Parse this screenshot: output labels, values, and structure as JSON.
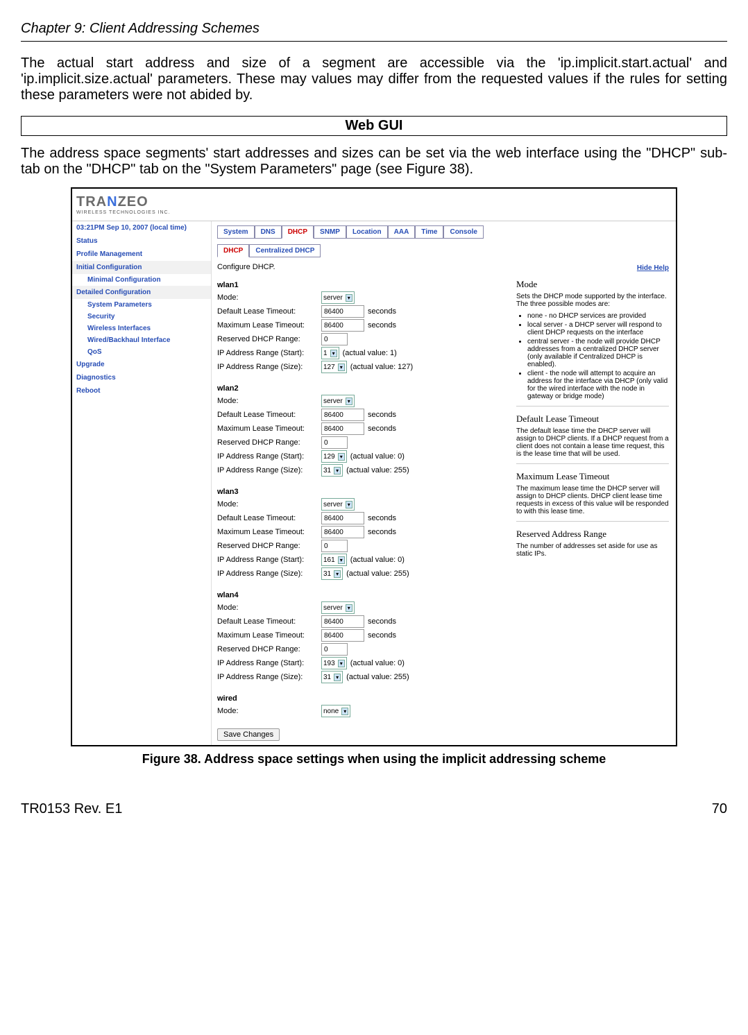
{
  "header": {
    "chapter_title": "Chapter 9: Client Addressing Schemes"
  },
  "body": {
    "para1": "The actual start address and size of a segment are accessible via the 'ip.implicit.start.actual' and 'ip.implicit.size.actual' parameters. These may values may differ from the requested values if the rules for setting these parameters were not abided by.",
    "webgui_title": "Web GUI",
    "para2": "The address space segments' start addresses and sizes can be set via the web interface using the \"DHCP\" sub-tab on the \"DHCP\" tab on the \"System Parameters\" page (see Figure 38)."
  },
  "screenshot": {
    "logo": {
      "brand_pre": "TRA",
      "brand_mid": "N",
      "brand_post": "ZEO",
      "subtitle": "WIRELESS TECHNOLOGIES INC."
    },
    "time_line": "03:21PM Sep 10, 2007 (local time)",
    "side": {
      "top": [
        "Status",
        "Profile Management"
      ],
      "sect1": "Initial Configuration",
      "sect1_items": [
        "Minimal Configuration"
      ],
      "sect2": "Detailed Configuration",
      "sect2_items": [
        "System Parameters",
        "Security",
        "Wireless Interfaces",
        "Wired/Backhaul Interface",
        "QoS"
      ],
      "rest": [
        "Upgrade",
        "Diagnostics",
        "Reboot"
      ]
    },
    "tabs": [
      "System",
      "DNS",
      "DHCP",
      "SNMP",
      "Location",
      "AAA",
      "Time",
      "Console"
    ],
    "active_tab": "DHCP",
    "subtabs": [
      "DHCP",
      "Centralized DHCP"
    ],
    "active_subtab": "DHCP",
    "configure_text": "Configure DHCP.",
    "labels": {
      "mode": "Mode:",
      "dlt": "Default Lease Timeout:",
      "mlt": "Maximum Lease Timeout:",
      "res": "Reserved DHCP Range:",
      "start": "IP Address Range (Start):",
      "size": "IP Address Range (Size):",
      "seconds": "seconds"
    },
    "ifaces": [
      {
        "name": "wlan1",
        "mode": "server",
        "dlt": "86400",
        "mlt": "86400",
        "res": "0",
        "start": "1",
        "start_act": "(actual value: 1)",
        "size": "127",
        "size_act": "(actual value: 127)"
      },
      {
        "name": "wlan2",
        "mode": "server",
        "dlt": "86400",
        "mlt": "86400",
        "res": "0",
        "start": "129",
        "start_act": "(actual value: 0)",
        "size": "31",
        "size_act": "(actual value: 255)"
      },
      {
        "name": "wlan3",
        "mode": "server",
        "dlt": "86400",
        "mlt": "86400",
        "res": "0",
        "start": "161",
        "start_act": "(actual value: 0)",
        "size": "31",
        "size_act": "(actual value: 255)"
      },
      {
        "name": "wlan4",
        "mode": "server",
        "dlt": "86400",
        "mlt": "86400",
        "res": "0",
        "start": "193",
        "start_act": "(actual value: 0)",
        "size": "31",
        "size_act": "(actual value: 255)"
      }
    ],
    "wired": {
      "name": "wired",
      "mode": "none"
    },
    "save_btn": "Save Changes",
    "help": {
      "hide": "Hide Help",
      "mode": {
        "title": "Mode",
        "intro": "Sets the DHCP mode supported by the interface. The three possible modes are:",
        "items": [
          "none - no DHCP services are provided",
          "local server - a DHCP server will respond to client DHCP requests on the interface",
          "central server - the node will provide DHCP addresses from a centralized DHCP server (only available if Centralized DHCP is enabled).",
          "client - the node will attempt to acquire an address for the interface via DHCP (only valid for the wired interface with the node in gateway or bridge mode)"
        ]
      },
      "dlt": {
        "title": "Default Lease Timeout",
        "text": "The default lease time the DHCP server will assign to DHCP clients. If a DHCP request from a client does not contain a lease time request, this is the lease time that will be used."
      },
      "mlt": {
        "title": "Maximum Lease Timeout",
        "text": "The maximum lease time the DHCP server will assign to DHCP clients. DHCP client lease time requests in excess of this value will be responded to with this lease time."
      },
      "res": {
        "title": "Reserved Address Range",
        "text": "The number of addresses set aside for use as static IPs."
      }
    }
  },
  "figure_caption": "Figure 38. Address space settings when using the implicit addressing scheme",
  "footer": {
    "left": "TR0153 Rev. E1",
    "right": "70"
  }
}
